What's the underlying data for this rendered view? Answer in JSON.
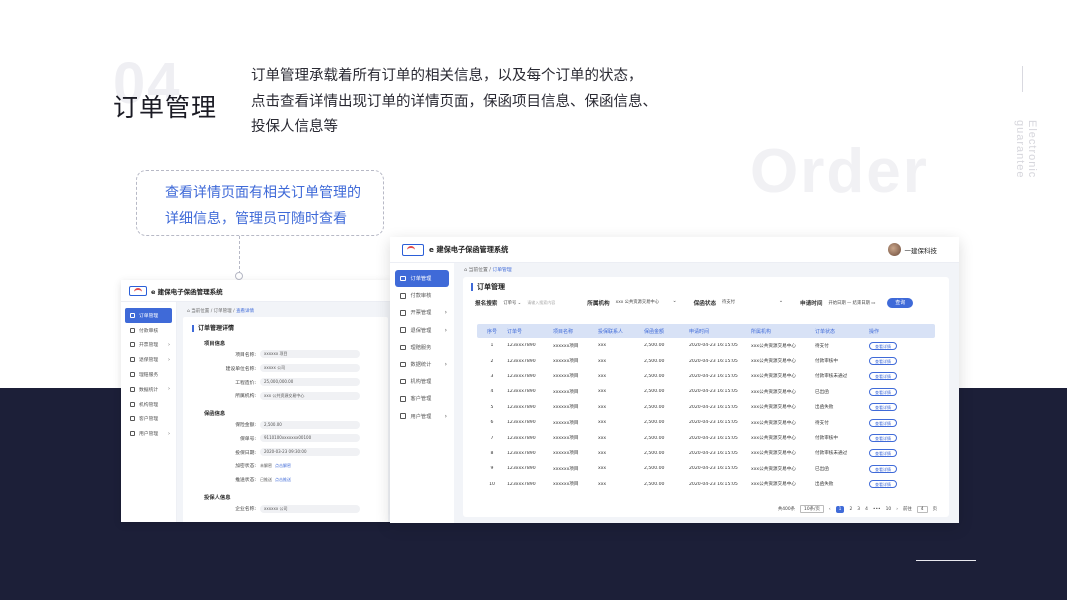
{
  "section": {
    "number": "04",
    "title": "订单管理",
    "description_lines": [
      "订单管理承载着所有订单的相关信息，以及每个订单的状态，",
      "点击查看详情出现订单的详情页面，保函项目信息、保函信息、",
      "投保人信息等"
    ],
    "watermark": "Order",
    "vertical_text": "Electronic guarantee"
  },
  "callout": {
    "lines": [
      "查看详情页面有相关订单管理的",
      "详细信息，管理员可随时查看"
    ]
  },
  "detail_screen": {
    "brand": "e 建保电子保函管理系统",
    "breadcrumb_prefix": "当前位置 / 订单管理 /",
    "breadcrumb_current": "查看详情",
    "page_title": "订单管理详情",
    "menu": [
      "订单管理",
      "付款审核",
      "开票管理",
      "退保管理",
      "理赔服务",
      "数据统计",
      "机构管理",
      "客户管理",
      "用户管理"
    ],
    "groups": [
      {
        "title": "项目信息",
        "fields": [
          {
            "label": "项目名称:",
            "value": "xxxxxx 项目"
          },
          {
            "label": "建设单位名称:",
            "value": "xxxxx 公司"
          },
          {
            "label": "工程造价:",
            "value": "25,000,000.00"
          },
          {
            "label": "所属机构:",
            "value": "xxx 公共资源交易中心"
          }
        ]
      },
      {
        "title": "保函信息",
        "fields": [
          {
            "label": "保险金额:",
            "value": "2,500.00"
          },
          {
            "label": "保单号:",
            "value": "9110100xxxxxxx00100"
          },
          {
            "label": "投保日期:",
            "value": "2020-03-23 09:30:00"
          },
          {
            "label": "加密状态:",
            "value": "未解密",
            "link": "点击解密"
          },
          {
            "label": "推送状态:",
            "value": "已推送",
            "link": "点击推送"
          }
        ]
      },
      {
        "title": "投保人信息",
        "fields": [
          {
            "label": "企业名称:",
            "value": "xxxxxx 公司"
          }
        ]
      }
    ]
  },
  "list_screen": {
    "brand": "e 建保电子保函管理系统",
    "user_name": "一建保科技",
    "breadcrumb_prefix": "当前位置 /",
    "breadcrumb_current": "订单管理",
    "page_title": "订单管理",
    "menu": [
      "订单管理",
      "付款审核",
      "开票管理",
      "退保管理",
      "理赔服务",
      "数据统计",
      "机构管理",
      "客户管理",
      "用户管理"
    ],
    "filters": {
      "search_label": "报名搜索",
      "search_type": "订单号",
      "search_placeholder": "请输入搜索内容",
      "org_label": "所属机构",
      "org_value": "xxx 公共资源交易中心",
      "status_label": "保函状态",
      "status_value": "待支付",
      "time_label": "申请时间",
      "start_date": "开始日期",
      "range_sep": "—",
      "end_date": "结束日期",
      "query_button": "查询"
    },
    "columns": [
      "序号",
      "订单号",
      "项目名称",
      "投保联系人",
      "保函金额",
      "申请时间",
      "所属机构",
      "订单状态",
      "操作"
    ],
    "rows": [
      [
        "1",
        "123xxx7890",
        "xxxxxx项目",
        "xxx",
        "2,500.00",
        "2020-04-23 16:15:05",
        "xxx公共资源交易中心",
        "待支付",
        "查看详情"
      ],
      [
        "2",
        "123xxx7890",
        "xxxxxx项目",
        "xxx",
        "2,500.00",
        "2020-04-23 16:15:05",
        "xxx公共资源交易中心",
        "付款审核中",
        "查看详情"
      ],
      [
        "3",
        "123xxx7890",
        "xxxxxx项目",
        "xxx",
        "2,500.00",
        "2020-04-23 16:15:05",
        "xxx公共资源交易中心",
        "付款审核未通过",
        "查看详情"
      ],
      [
        "4",
        "123xxx7890",
        "xxxxxx项目",
        "xxx",
        "2,500.00",
        "2020-04-23 16:15:05",
        "xxx公共资源交易中心",
        "已出函",
        "查看详情"
      ],
      [
        "5",
        "123xxx7890",
        "xxxxxx项目",
        "xxx",
        "2,500.00",
        "2020-04-23 16:15:05",
        "xxx公共资源交易中心",
        "出函失败",
        "查看详情"
      ],
      [
        "6",
        "123xxx7890",
        "xxxxxx项目",
        "xxx",
        "2,500.00",
        "2020-04-23 16:15:05",
        "xxx公共资源交易中心",
        "待支付",
        "查看详情"
      ],
      [
        "7",
        "123xxx7890",
        "xxxxxx项目",
        "xxx",
        "2,500.00",
        "2020-04-23 16:15:05",
        "xxx公共资源交易中心",
        "付款审核中",
        "查看详情"
      ],
      [
        "8",
        "123xxx7890",
        "xxxxxx项目",
        "xxx",
        "2,500.00",
        "2020-04-23 16:15:05",
        "xxx公共资源交易中心",
        "付款审核未通过",
        "查看详情"
      ],
      [
        "9",
        "123xxx7890",
        "xxxxxx项目",
        "xxx",
        "2,500.00",
        "2020-04-23 16:15:05",
        "xxx公共资源交易中心",
        "已出函",
        "查看详情"
      ],
      [
        "10",
        "123xxx7890",
        "xxxxxx项目",
        "xxx",
        "2,500.00",
        "2020-04-23 16:15:05",
        "xxx公共资源交易中心",
        "出函失败",
        "查看详情"
      ]
    ],
    "pagination": {
      "total": "共400条",
      "page_size": "10条/页",
      "prev": "‹",
      "pages": [
        "1",
        "2",
        "3",
        "4",
        "•••",
        "10"
      ],
      "current": "1",
      "next": "›",
      "goto_label": "前往",
      "goto_value": "4",
      "goto_suffix": "页"
    }
  },
  "colors": {
    "accent": "#3f6ad8",
    "navy": "#1c1f38",
    "table_header": "#d8e2f6"
  }
}
